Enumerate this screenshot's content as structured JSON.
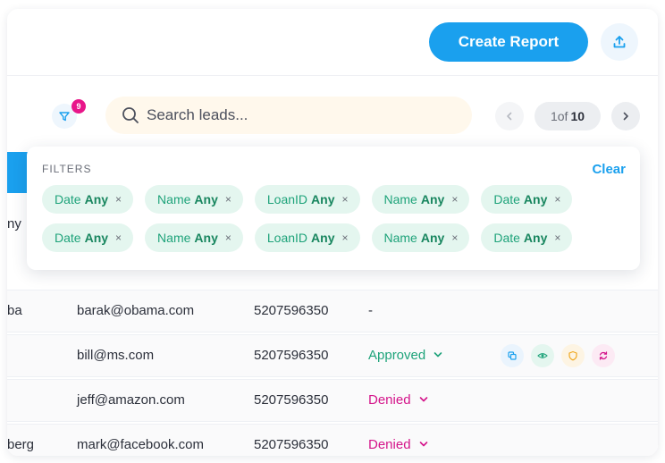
{
  "header": {
    "create_report_label": "Create Report"
  },
  "toolbar": {
    "filter_badge_count": "9",
    "search_placeholder": "Search leads...",
    "pagination": {
      "current": "1",
      "of": "of",
      "total": "10"
    }
  },
  "table": {
    "header_fragment": "ny",
    "rows": [
      {
        "name": "ba",
        "email": "barak@obama.com",
        "phone": "5207596350",
        "status": "-",
        "status_type": "none"
      },
      {
        "name": "",
        "email": "bill@ms.com",
        "phone": "5207596350",
        "status": "Approved",
        "status_type": "approved"
      },
      {
        "name": "",
        "email": "jeff@amazon.com",
        "phone": "5207596350",
        "status": "Denied",
        "status_type": "denied"
      },
      {
        "name": "berg",
        "email": "mark@facebook.com",
        "phone": "5207596350",
        "status": "Denied",
        "status_type": "denied"
      }
    ]
  },
  "filters": {
    "title": "FILTERS",
    "clear_label": "Clear",
    "chips_row1": [
      {
        "label": "Date",
        "value": "Any"
      },
      {
        "label": "Name",
        "value": "Any"
      },
      {
        "label": "LoanID",
        "value": "Any"
      },
      {
        "label": "Name",
        "value": "Any"
      },
      {
        "label": "Date",
        "value": "Any"
      }
    ],
    "chips_row2": [
      {
        "label": "Date",
        "value": "Any"
      },
      {
        "label": "Name",
        "value": "Any"
      },
      {
        "label": "LoanID",
        "value": "Any"
      },
      {
        "label": "Name",
        "value": "Any"
      },
      {
        "label": "Date",
        "value": "Any"
      }
    ],
    "remove_glyph": "×"
  },
  "icons": {
    "upload": "upload-icon",
    "filter": "funnel-icon",
    "search": "search-icon",
    "prev": "chevron-left-icon",
    "next": "chevron-right-icon",
    "actions": [
      "copy-icon",
      "eye-icon",
      "shield-icon",
      "refresh-icon"
    ]
  },
  "colors": {
    "primary": "#1aa0ee",
    "approved": "#1ea37a",
    "denied": "#d4148a",
    "badge": "#e8168a",
    "chip_bg": "#e4f6ef"
  }
}
